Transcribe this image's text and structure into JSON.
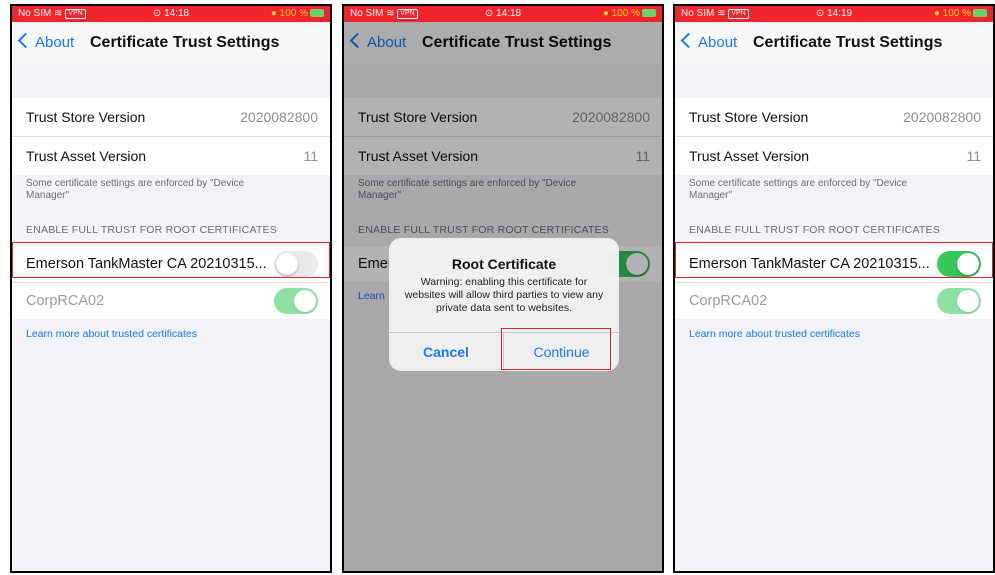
{
  "colors": {
    "status_bar": "#f0242c",
    "accent": "#1677ff",
    "toggle_on": "#34c759",
    "highlight": "#d7262c"
  },
  "panels": [
    {
      "status": {
        "carrier": "No SIM",
        "vpn": "VPN",
        "time": "⊙ 14:18",
        "battery": "● 100 %"
      },
      "nav": {
        "back_label": "About",
        "title": "Certificate Trust Settings"
      },
      "rows": [
        {
          "label": "Trust Store Version",
          "value": "2020082800"
        },
        {
          "label": "Trust Asset Version",
          "value": "11"
        }
      ],
      "footnote": "Some certificate settings are enforced by \"Device Manager\"",
      "section_header": "ENABLE FULL TRUST FOR ROOT CERTIFICATES",
      "certs": [
        {
          "label": "Emerson TankMaster CA 20210315...",
          "enabled": false
        },
        {
          "label": "CorpRCA02",
          "enabled": true
        }
      ],
      "learn_more": "Learn more about trusted certificates"
    },
    {
      "status": {
        "carrier": "No SIM",
        "vpn": "VPN",
        "time": "⊙ 14:18",
        "battery": "● 100 %"
      },
      "nav": {
        "back_label": "About",
        "title": "Certificate Trust Settings"
      },
      "rows": [
        {
          "label": "Trust Store Version",
          "value": "2020082800"
        },
        {
          "label": "Trust Asset Version",
          "value": "11"
        }
      ],
      "footnote": "Some certificate settings are enforced by \"Device Manager\"",
      "section_header": "ENABLE FULL TRUST FOR ROOT CERTIFICATES",
      "certs": [
        {
          "label": "Emer",
          "enabled": true
        }
      ],
      "learn_more": "Learn",
      "alert": {
        "title": "Root Certificate",
        "message": "Warning: enabling this certificate for websites will allow third parties to view any private data sent to websites.",
        "cancel": "Cancel",
        "continue": "Continue"
      }
    },
    {
      "status": {
        "carrier": "No SIM",
        "vpn": "VPN",
        "time": "⊙ 14:19",
        "battery": "● 100 %"
      },
      "nav": {
        "back_label": "About",
        "title": "Certificate Trust Settings"
      },
      "rows": [
        {
          "label": "Trust Store Version",
          "value": "2020082800"
        },
        {
          "label": "Trust Asset Version",
          "value": "11"
        }
      ],
      "footnote": "Some certificate settings are enforced by \"Device Manager\"",
      "section_header": "ENABLE FULL TRUST FOR ROOT CERTIFICATES",
      "certs": [
        {
          "label": "Emerson TankMaster CA 20210315...",
          "enabled": true
        },
        {
          "label": "CorpRCA02",
          "enabled": true
        }
      ],
      "learn_more": "Learn more about trusted certificates"
    }
  ]
}
